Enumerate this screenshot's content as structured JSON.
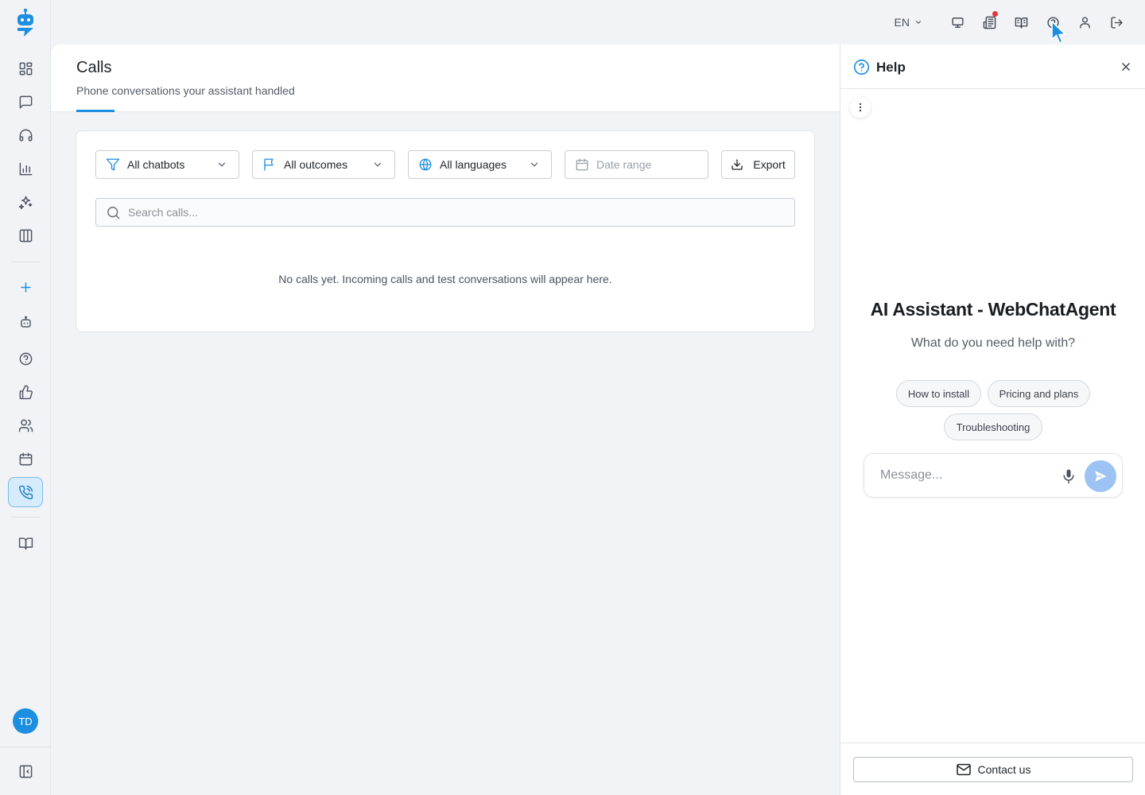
{
  "topbar": {
    "language": "EN",
    "icons": [
      "monitor-icon",
      "news-icon",
      "book-open-icon",
      "help-circle-icon",
      "user-icon",
      "logout-icon"
    ],
    "notification_color": "#e8363b"
  },
  "sidebar": {
    "avatar_initials": "TD",
    "active_item": "calls",
    "accent_color": "#1d8fe0"
  },
  "page": {
    "title": "Calls",
    "subtitle": "Phone conversations your assistant handled"
  },
  "filters": {
    "chatbots": "All chatbots",
    "outcomes": "All outcomes",
    "languages": "All languages",
    "date_placeholder": "Date range",
    "export_label": "Export"
  },
  "search": {
    "placeholder": "Search calls..."
  },
  "empty_state": "No calls yet. Incoming calls and test conversations will appear here.",
  "help": {
    "title": "Help",
    "assistant_name": "AI Assistant - WebChatAgent",
    "prompt": "What do you need help with?",
    "chips": [
      "How to install",
      "Pricing and plans",
      "Troubleshooting"
    ],
    "message_placeholder": "Message...",
    "contact_label": "Contact us"
  }
}
